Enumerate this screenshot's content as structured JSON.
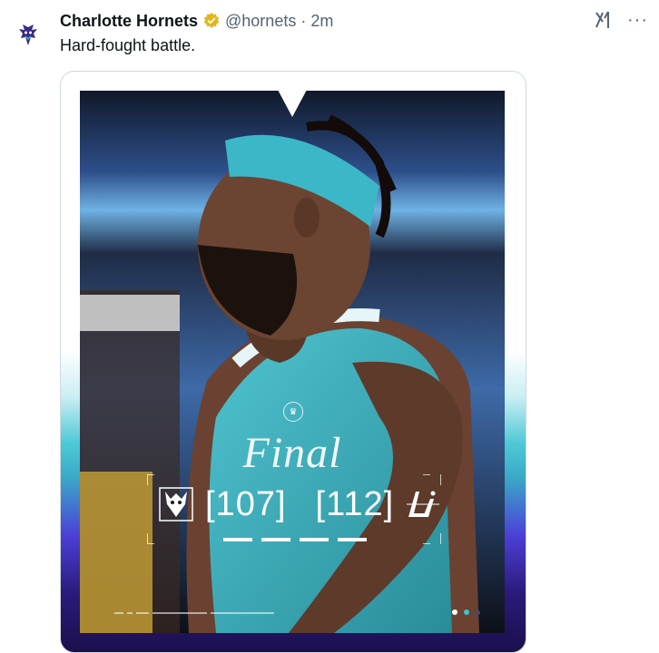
{
  "tweet": {
    "author_name": "Charlotte Hornets",
    "handle": "@hornets",
    "separator": "·",
    "time": "2m",
    "text": "Hard-fought battle.",
    "verified_color": "#e2b719"
  },
  "icons": {
    "avatar": "hornets-logo-icon",
    "verified": "verified-badge-icon",
    "grok": "grok-icon",
    "more": "more-icon"
  },
  "media": {
    "final_label": "Final",
    "home_score": "[107]",
    "away_score": "[112]",
    "home_team_logo": "hornets-logo-icon",
    "away_team_logo": "lakers-logo-icon",
    "colors": {
      "teal": "#3cc4d6",
      "purple": "#4b3fd6",
      "dark_purple": "#1b0f4c"
    }
  }
}
